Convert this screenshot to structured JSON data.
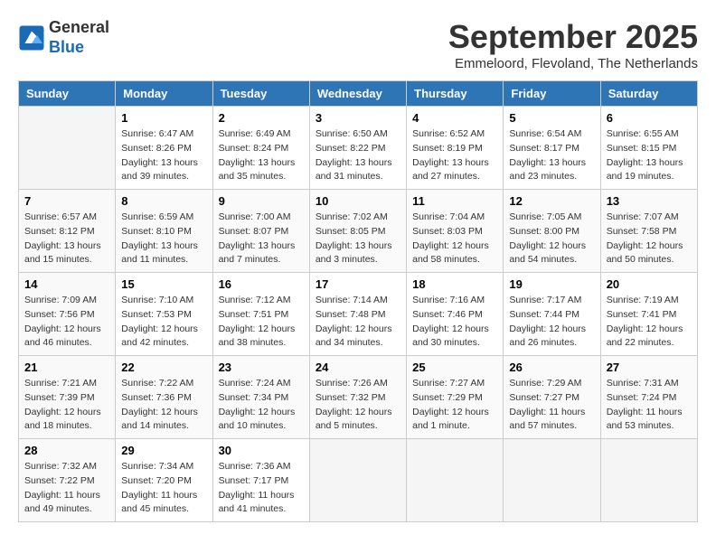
{
  "header": {
    "logo_line1": "General",
    "logo_line2": "Blue",
    "month": "September 2025",
    "location": "Emmeloord, Flevoland, The Netherlands"
  },
  "days_of_week": [
    "Sunday",
    "Monday",
    "Tuesday",
    "Wednesday",
    "Thursday",
    "Friday",
    "Saturday"
  ],
  "weeks": [
    [
      {
        "day": "",
        "info": ""
      },
      {
        "day": "1",
        "info": "Sunrise: 6:47 AM\nSunset: 8:26 PM\nDaylight: 13 hours\nand 39 minutes."
      },
      {
        "day": "2",
        "info": "Sunrise: 6:49 AM\nSunset: 8:24 PM\nDaylight: 13 hours\nand 35 minutes."
      },
      {
        "day": "3",
        "info": "Sunrise: 6:50 AM\nSunset: 8:22 PM\nDaylight: 13 hours\nand 31 minutes."
      },
      {
        "day": "4",
        "info": "Sunrise: 6:52 AM\nSunset: 8:19 PM\nDaylight: 13 hours\nand 27 minutes."
      },
      {
        "day": "5",
        "info": "Sunrise: 6:54 AM\nSunset: 8:17 PM\nDaylight: 13 hours\nand 23 minutes."
      },
      {
        "day": "6",
        "info": "Sunrise: 6:55 AM\nSunset: 8:15 PM\nDaylight: 13 hours\nand 19 minutes."
      }
    ],
    [
      {
        "day": "7",
        "info": "Sunrise: 6:57 AM\nSunset: 8:12 PM\nDaylight: 13 hours\nand 15 minutes."
      },
      {
        "day": "8",
        "info": "Sunrise: 6:59 AM\nSunset: 8:10 PM\nDaylight: 13 hours\nand 11 minutes."
      },
      {
        "day": "9",
        "info": "Sunrise: 7:00 AM\nSunset: 8:07 PM\nDaylight: 13 hours\nand 7 minutes."
      },
      {
        "day": "10",
        "info": "Sunrise: 7:02 AM\nSunset: 8:05 PM\nDaylight: 13 hours\nand 3 minutes."
      },
      {
        "day": "11",
        "info": "Sunrise: 7:04 AM\nSunset: 8:03 PM\nDaylight: 12 hours\nand 58 minutes."
      },
      {
        "day": "12",
        "info": "Sunrise: 7:05 AM\nSunset: 8:00 PM\nDaylight: 12 hours\nand 54 minutes."
      },
      {
        "day": "13",
        "info": "Sunrise: 7:07 AM\nSunset: 7:58 PM\nDaylight: 12 hours\nand 50 minutes."
      }
    ],
    [
      {
        "day": "14",
        "info": "Sunrise: 7:09 AM\nSunset: 7:56 PM\nDaylight: 12 hours\nand 46 minutes."
      },
      {
        "day": "15",
        "info": "Sunrise: 7:10 AM\nSunset: 7:53 PM\nDaylight: 12 hours\nand 42 minutes."
      },
      {
        "day": "16",
        "info": "Sunrise: 7:12 AM\nSunset: 7:51 PM\nDaylight: 12 hours\nand 38 minutes."
      },
      {
        "day": "17",
        "info": "Sunrise: 7:14 AM\nSunset: 7:48 PM\nDaylight: 12 hours\nand 34 minutes."
      },
      {
        "day": "18",
        "info": "Sunrise: 7:16 AM\nSunset: 7:46 PM\nDaylight: 12 hours\nand 30 minutes."
      },
      {
        "day": "19",
        "info": "Sunrise: 7:17 AM\nSunset: 7:44 PM\nDaylight: 12 hours\nand 26 minutes."
      },
      {
        "day": "20",
        "info": "Sunrise: 7:19 AM\nSunset: 7:41 PM\nDaylight: 12 hours\nand 22 minutes."
      }
    ],
    [
      {
        "day": "21",
        "info": "Sunrise: 7:21 AM\nSunset: 7:39 PM\nDaylight: 12 hours\nand 18 minutes."
      },
      {
        "day": "22",
        "info": "Sunrise: 7:22 AM\nSunset: 7:36 PM\nDaylight: 12 hours\nand 14 minutes."
      },
      {
        "day": "23",
        "info": "Sunrise: 7:24 AM\nSunset: 7:34 PM\nDaylight: 12 hours\nand 10 minutes."
      },
      {
        "day": "24",
        "info": "Sunrise: 7:26 AM\nSunset: 7:32 PM\nDaylight: 12 hours\nand 5 minutes."
      },
      {
        "day": "25",
        "info": "Sunrise: 7:27 AM\nSunset: 7:29 PM\nDaylight: 12 hours\nand 1 minute."
      },
      {
        "day": "26",
        "info": "Sunrise: 7:29 AM\nSunset: 7:27 PM\nDaylight: 11 hours\nand 57 minutes."
      },
      {
        "day": "27",
        "info": "Sunrise: 7:31 AM\nSunset: 7:24 PM\nDaylight: 11 hours\nand 53 minutes."
      }
    ],
    [
      {
        "day": "28",
        "info": "Sunrise: 7:32 AM\nSunset: 7:22 PM\nDaylight: 11 hours\nand 49 minutes."
      },
      {
        "day": "29",
        "info": "Sunrise: 7:34 AM\nSunset: 7:20 PM\nDaylight: 11 hours\nand 45 minutes."
      },
      {
        "day": "30",
        "info": "Sunrise: 7:36 AM\nSunset: 7:17 PM\nDaylight: 11 hours\nand 41 minutes."
      },
      {
        "day": "",
        "info": ""
      },
      {
        "day": "",
        "info": ""
      },
      {
        "day": "",
        "info": ""
      },
      {
        "day": "",
        "info": ""
      }
    ]
  ]
}
